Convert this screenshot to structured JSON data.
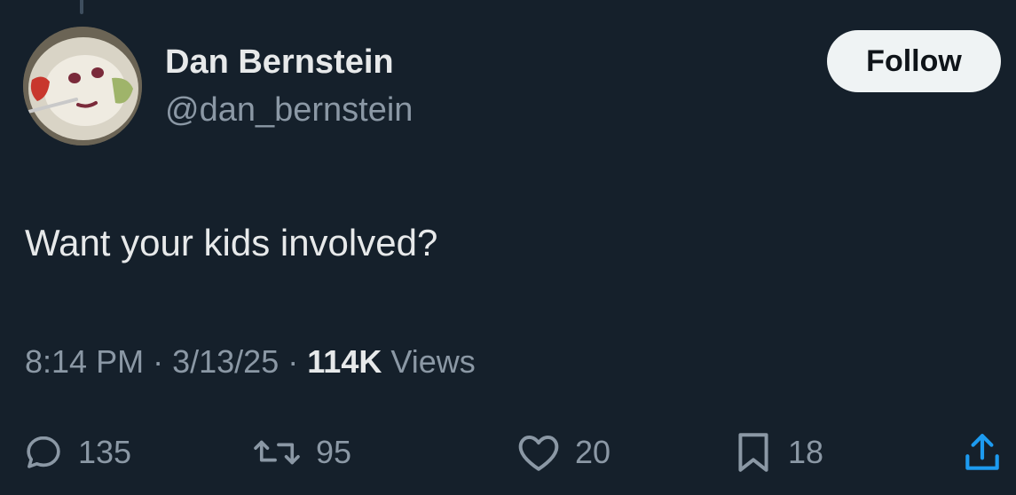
{
  "author": {
    "name": "Dan Bernstein",
    "handle": "@dan_bernstein",
    "avatar_icon": "plate-face-avatar"
  },
  "follow_label": "Follow",
  "tweet": {
    "text": "Want your kids involved?",
    "time": "8:14 PM",
    "separator": "·",
    "date": "3/13/25",
    "views_count": "114K",
    "views_label": "Views"
  },
  "actions": {
    "reply": {
      "icon": "reply-icon",
      "count": "135"
    },
    "retweet": {
      "icon": "retweet-icon",
      "count": "95"
    },
    "like": {
      "icon": "heart-icon",
      "count": "20"
    },
    "bookmark": {
      "icon": "bookmark-icon",
      "count": "18"
    },
    "share": {
      "icon": "share-icon"
    }
  },
  "colors": {
    "background": "#15202b",
    "primary_text": "#e7e9ea",
    "secondary_text": "#8b98a5",
    "follow_button_bg": "#eff3f4"
  }
}
